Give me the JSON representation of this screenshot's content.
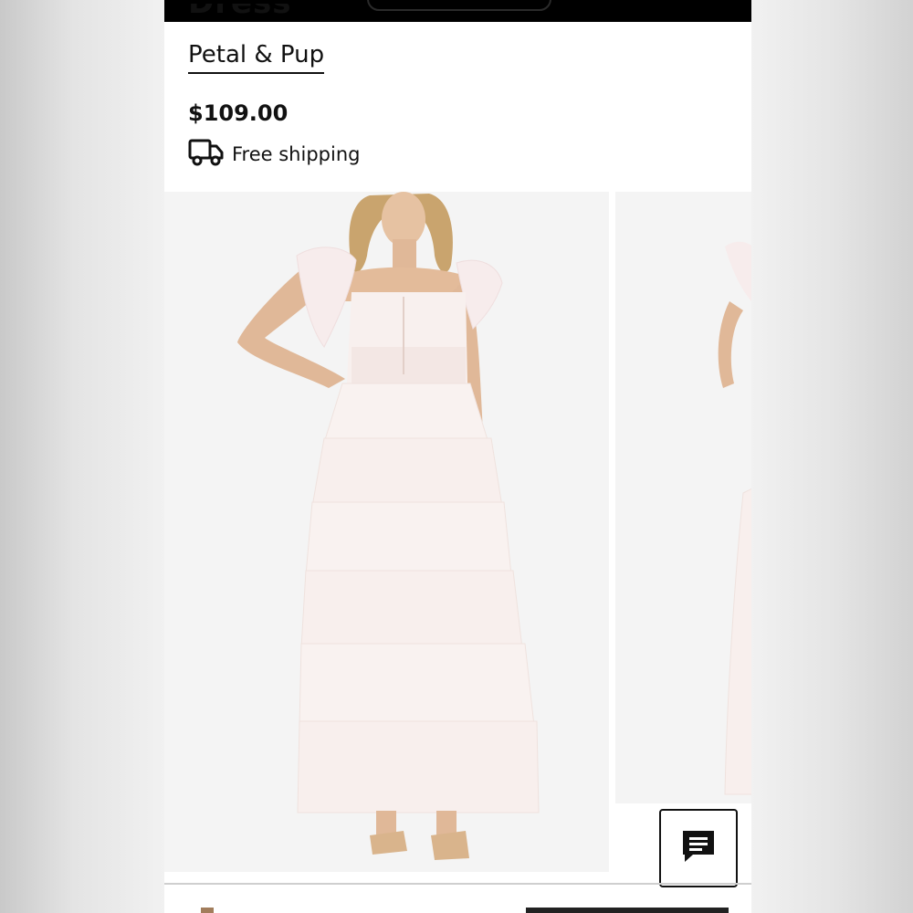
{
  "product": {
    "title": "Dress",
    "brand": "Petal & Pup",
    "price": "$109.00",
    "shipping": "Free shipping"
  },
  "icons": {
    "shipping": "truck-icon",
    "chat": "chat-icon"
  },
  "gallery": {
    "main_image": "white tiered tulle maxi dress",
    "next_image": "dress side view"
  }
}
